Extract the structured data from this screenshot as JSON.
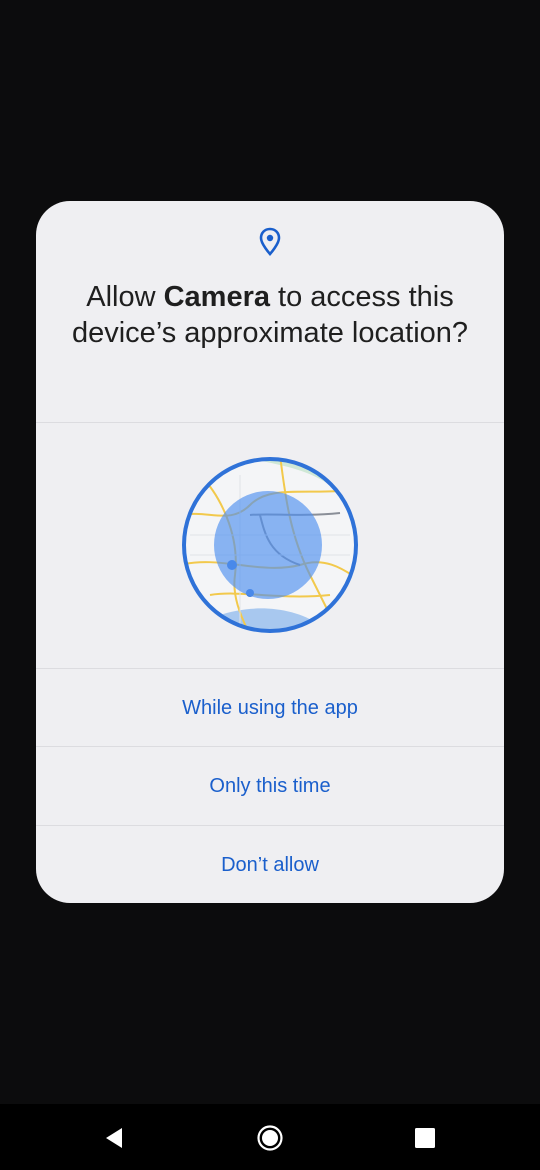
{
  "dialog": {
    "icon": "location-pin-icon",
    "title_prefix": "Allow ",
    "title_app": "Camera",
    "title_suffix": " to access this device’s approximate location?",
    "illustration": "approximate-location-map-icon",
    "options": [
      {
        "label": "While using the app"
      },
      {
        "label": "Only this time"
      },
      {
        "label": "Don’t allow"
      }
    ]
  },
  "colors": {
    "background": "#0c0c0d",
    "dialog_bg": "#efeff2",
    "accent": "#1a5fcc",
    "title_text": "#1f1f1f"
  },
  "navbar": {
    "back": "back-triangle-icon",
    "home": "home-circle-icon",
    "recents": "recents-square-icon"
  }
}
